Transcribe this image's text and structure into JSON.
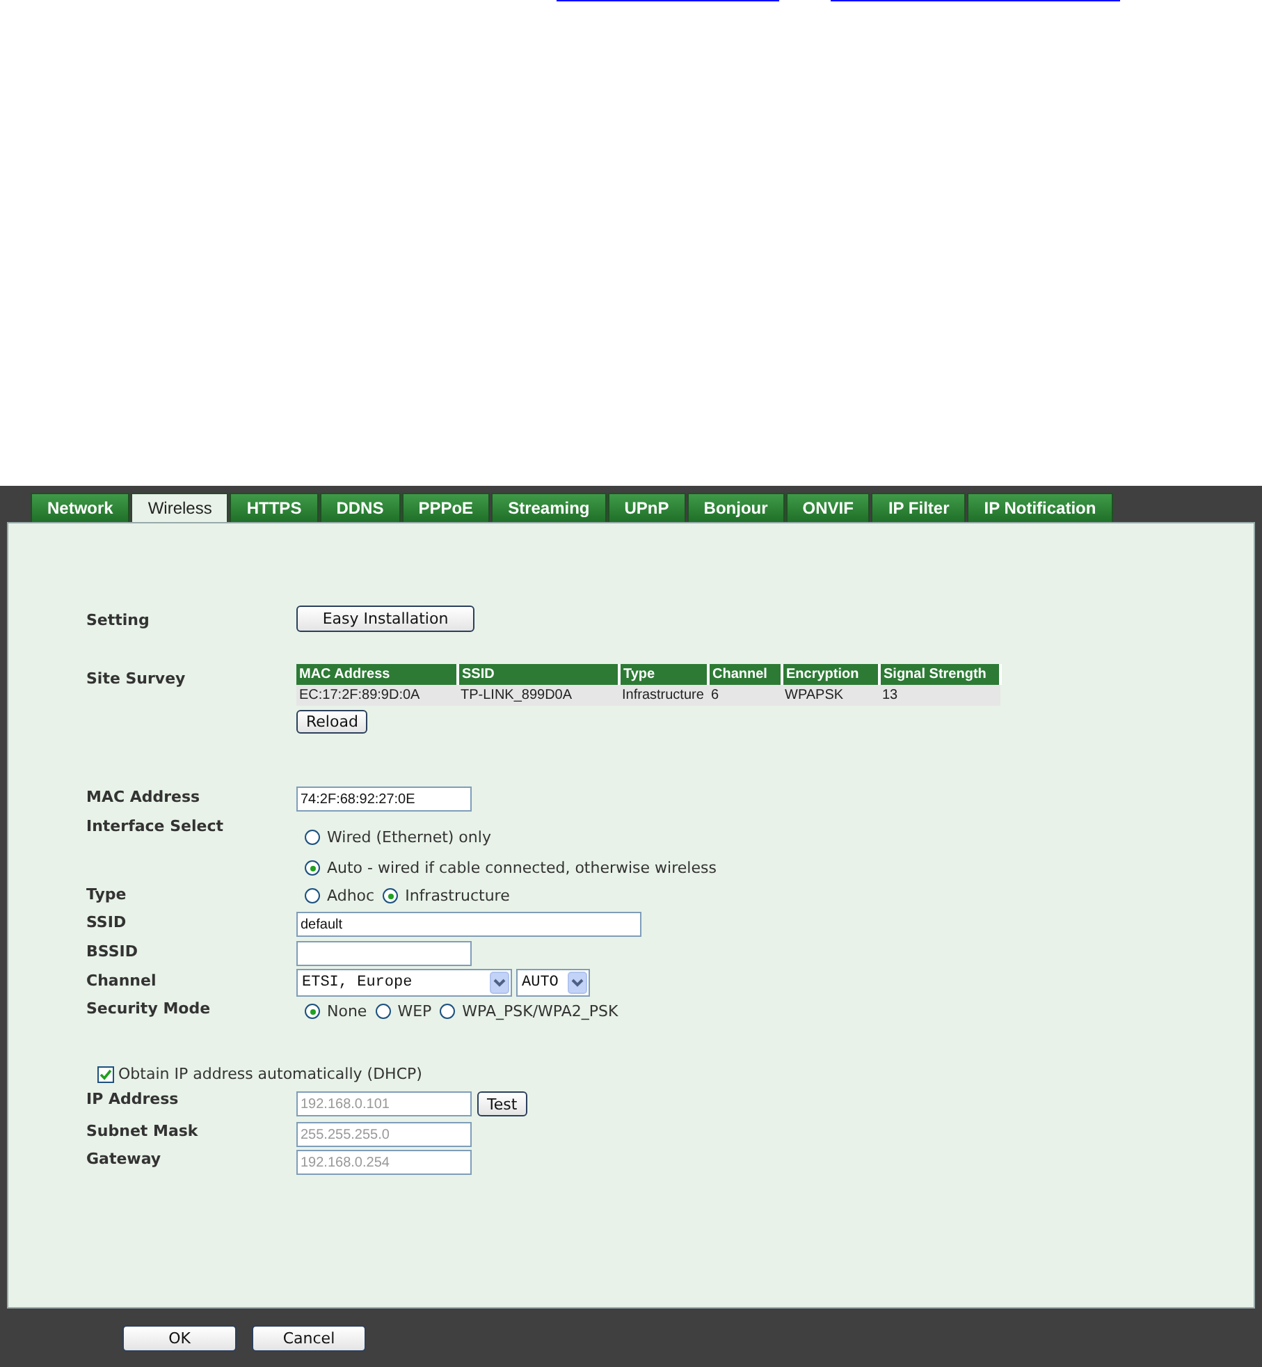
{
  "tabs": [
    {
      "label": "Network",
      "selected": false
    },
    {
      "label": "Wireless",
      "selected": true
    },
    {
      "label": "HTTPS",
      "selected": false
    },
    {
      "label": "DDNS",
      "selected": false
    },
    {
      "label": "PPPoE",
      "selected": false
    },
    {
      "label": "Streaming",
      "selected": false
    },
    {
      "label": "UPnP",
      "selected": false
    },
    {
      "label": "Bonjour",
      "selected": false
    },
    {
      "label": "ONVIF",
      "selected": false
    },
    {
      "label": "IP Filter",
      "selected": false
    },
    {
      "label": "IP Notification",
      "selected": false
    }
  ],
  "setting": {
    "label": "Setting",
    "button": "Easy Installation"
  },
  "site_survey": {
    "label": "Site Survey",
    "columns": [
      "MAC Address",
      "SSID",
      "Type",
      "Channel",
      "Encryption",
      "Signal Strength"
    ],
    "rows": [
      [
        "EC:17:2F:89:9D:0A",
        "TP-LINK_899D0A",
        "Infrastructure",
        "6",
        "WPAPSK",
        "13"
      ]
    ],
    "button": "Reload"
  },
  "mac_address": {
    "label": "MAC Address",
    "value": "74:2F:68:92:27:0E"
  },
  "interface_select": {
    "label": "Interface Select",
    "options": [
      {
        "label": "Wired (Ethernet) only",
        "selected": false
      },
      {
        "label": "Auto - wired if cable connected, otherwise wireless",
        "selected": true
      }
    ]
  },
  "type": {
    "label": "Type",
    "options": [
      {
        "label": "Adhoc",
        "selected": false
      },
      {
        "label": "Infrastructure",
        "selected": true
      }
    ]
  },
  "ssid": {
    "label": "SSID",
    "value": "default"
  },
  "bssid": {
    "label": "BSSID"
  },
  "channel": {
    "label": "Channel",
    "region": "ETSI, Europe",
    "channel": "AUTO"
  },
  "security_mode": {
    "label": "Security Mode",
    "options": [
      {
        "label": "None",
        "selected": true
      },
      {
        "label": "WEP",
        "selected": false
      },
      {
        "label": "WPA_PSK/WPA2_PSK",
        "selected": false
      }
    ]
  },
  "dhcp": {
    "label": "Obtain IP address automatically (DHCP)",
    "checked": true
  },
  "ip_address": {
    "label": "IP Address",
    "value": "192.168.0.101",
    "disabled": true,
    "button": "Test"
  },
  "subnet_mask": {
    "label": "Subnet Mask",
    "value": "255.255.255.0",
    "disabled": true
  },
  "gateway": {
    "label": "Gateway",
    "value": "192.168.0.254",
    "disabled": true
  },
  "buttons": [
    "OK",
    "Cancel"
  ]
}
